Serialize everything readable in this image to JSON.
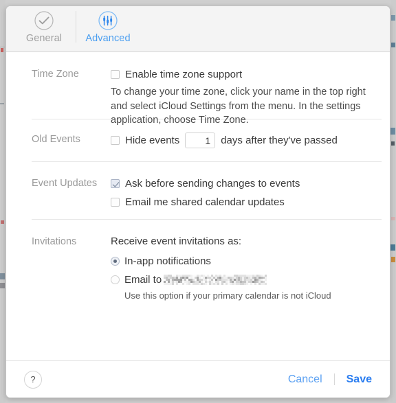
{
  "toolbar": {
    "tabs": [
      {
        "label": "General",
        "icon": "check-circle-icon",
        "active": false
      },
      {
        "label": "Advanced",
        "icon": "sliders-circle-icon",
        "active": true
      }
    ]
  },
  "sections": {
    "time_zone": {
      "label": "Time Zone",
      "checkbox_label": "Enable time zone support",
      "checkbox_checked": false,
      "helper": "To change your time zone, click your name in the top right and select iCloud Settings from the menu. In the settings application, choose Time Zone."
    },
    "old_events": {
      "label": "Old Events",
      "checkbox_label": "Hide events",
      "checkbox_checked": false,
      "days_value": "1",
      "days_placeholder": "1",
      "suffix_label": "days after they've passed"
    },
    "event_updates": {
      "label": "Event Updates",
      "options": [
        {
          "label": "Ask before sending changes to events",
          "checked": true
        },
        {
          "label": "Email me shared calendar updates",
          "checked": false
        }
      ]
    },
    "invitations": {
      "label": "Invitations",
      "lead": "Receive event invitations as:",
      "options": [
        {
          "label": "In-app notifications",
          "selected": true
        },
        {
          "label": "Email to",
          "selected": false,
          "value_redacted": true
        }
      ],
      "helper": "Use this option if your primary calendar is not iCloud"
    }
  },
  "footer": {
    "help_label": "?",
    "cancel_label": "Cancel",
    "save_label": "Save"
  },
  "colors": {
    "accent_blue": "#2a7df0",
    "link_blue": "#5aa0f2",
    "tab_active": "#4a9ef0",
    "label_gray": "#9a9a9a",
    "text": "#3a3a3a"
  }
}
